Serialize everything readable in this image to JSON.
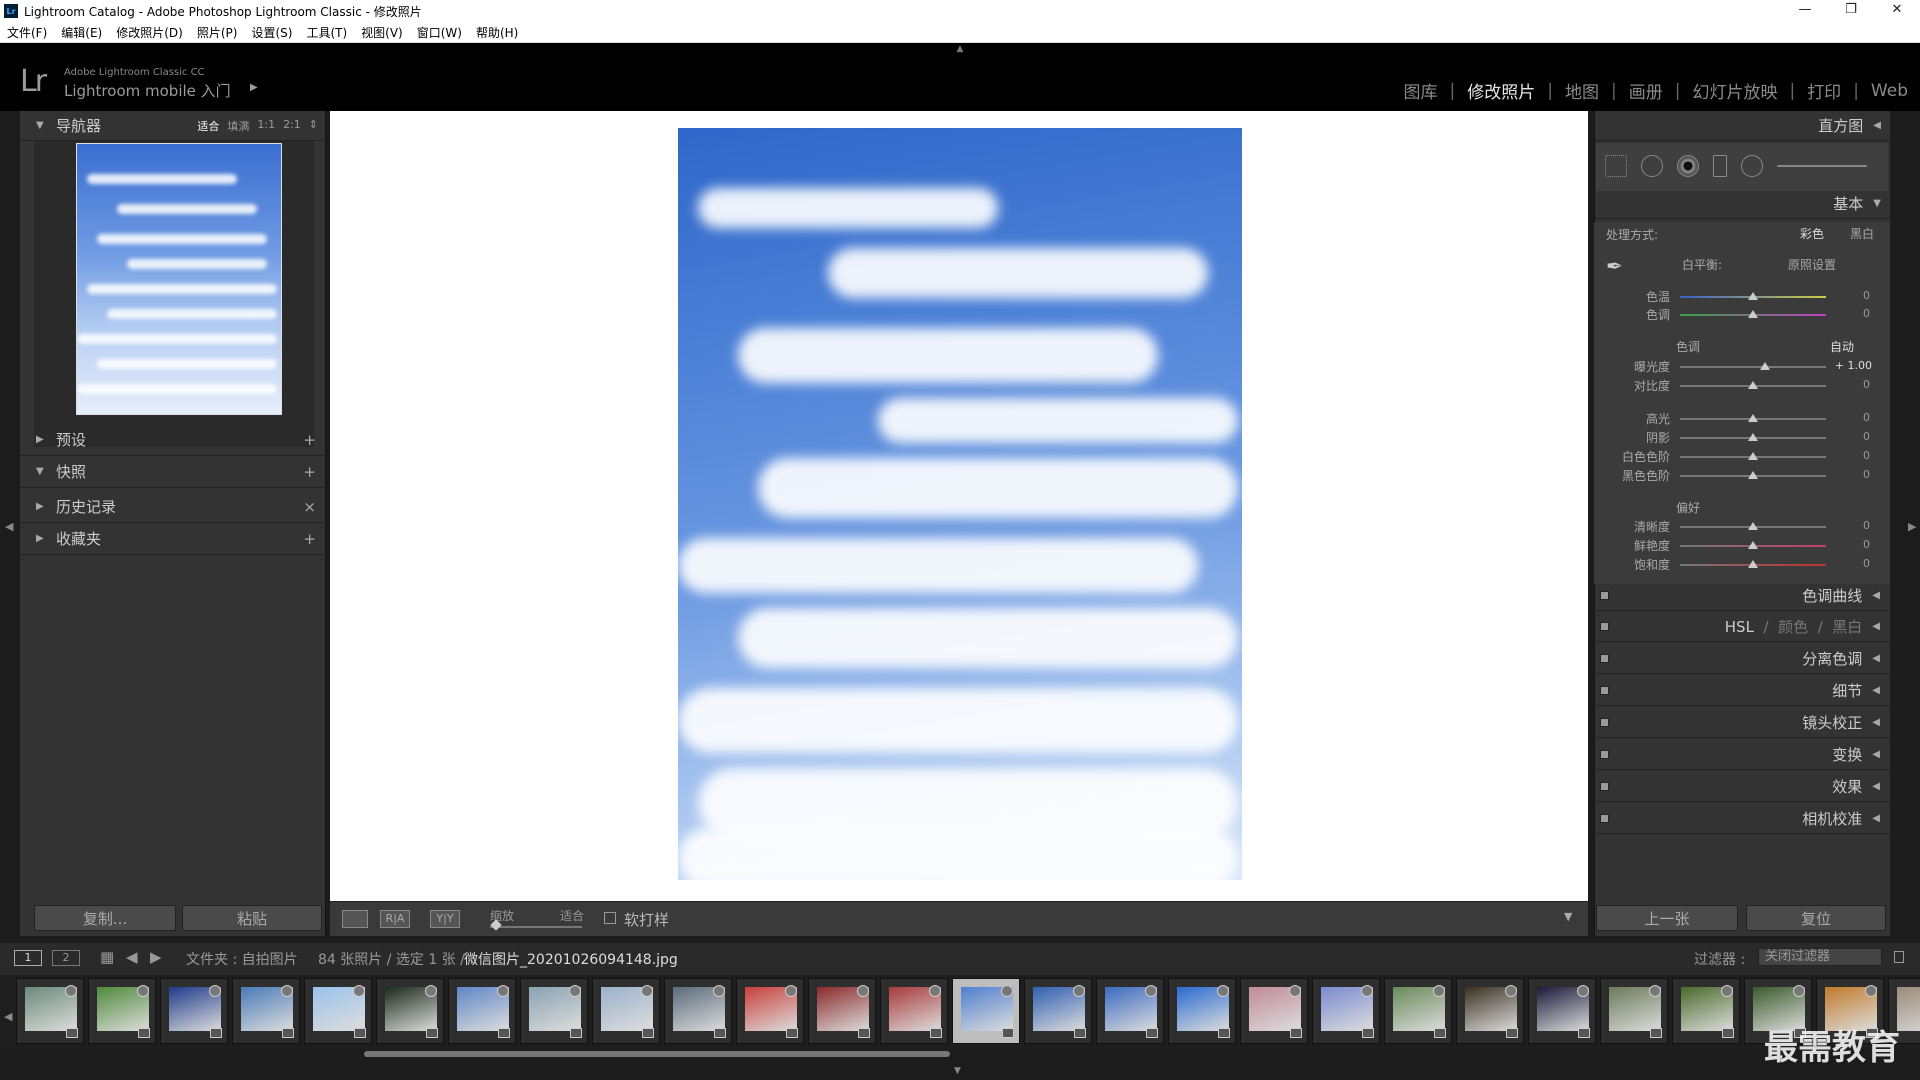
{
  "window": {
    "title": "Lightroom Catalog - Adobe Photoshop Lightroom Classic - 修改照片",
    "app_icon": "Lr",
    "controls": [
      "—",
      "❐",
      "✕"
    ]
  },
  "menu": [
    "文件(F)",
    "编辑(E)",
    "修改照片(D)",
    "照片(P)",
    "设置(S)",
    "工具(T)",
    "视图(V)",
    "窗口(W)",
    "帮助(H)"
  ],
  "identity": {
    "logo": "Lr",
    "product": "Adobe Lightroom Classic CC",
    "subtitle": "Lightroom mobile 入门",
    "arrow": "▶"
  },
  "modules": {
    "items": [
      "图库",
      "修改照片",
      "地图",
      "画册",
      "幻灯片放映",
      "打印",
      "Web"
    ],
    "active": "修改照片",
    "separator": "|"
  },
  "left_panel": {
    "navigator": {
      "label": "导航器",
      "zoom_options": [
        "适合",
        "填满",
        "1:1",
        "2:1"
      ],
      "zoom_active": "适合",
      "zoom_arrow": "⇕"
    },
    "presets": {
      "label": "预设",
      "action": "+"
    },
    "snapshots": {
      "label": "快照",
      "action": "+"
    },
    "history": {
      "label": "历史记录",
      "action": "×"
    },
    "collections": {
      "label": "收藏夹",
      "action": "+"
    },
    "buttons": {
      "copy": "复制...",
      "paste": "粘贴"
    }
  },
  "toolbar": {
    "view_loupe": "▭",
    "view_ra": "R|A",
    "view_yy": "Y|Y",
    "zoom_label": "缩放",
    "zoom_value": "适合",
    "soft_proof": "软打样",
    "dropdown": "▼"
  },
  "right_panel": {
    "histogram": {
      "label": "直方图"
    },
    "basic": {
      "label": "基本",
      "treatment_label": "处理方式:",
      "treatment_color": "彩色",
      "treatment_bw": "黑白",
      "wb_label": "白平衡:",
      "wb_value": "原照设置",
      "temp": {
        "label": "色温",
        "value": "0"
      },
      "tint": {
        "label": "色调",
        "value": "0"
      },
      "tone_label": "色调",
      "auto": "自动",
      "exposure": {
        "label": "曝光度",
        "value": "+ 1.00"
      },
      "contrast": {
        "label": "对比度",
        "value": "0"
      },
      "highlights": {
        "label": "高光",
        "value": "0"
      },
      "shadows": {
        "label": "阴影",
        "value": "0"
      },
      "whites": {
        "label": "白色色阶",
        "value": "0"
      },
      "blacks": {
        "label": "黑色色阶",
        "value": "0"
      },
      "presence_label": "偏好",
      "clarity": {
        "label": "清晰度",
        "value": "0"
      },
      "vibrance": {
        "label": "鲜艳度",
        "value": "0"
      },
      "saturation": {
        "label": "饱和度",
        "value": "0"
      }
    },
    "sections": [
      "色调曲线",
      "HSL / 颜色 / 黑白",
      "分离色调",
      "细节",
      "镜头校正",
      "变换",
      "效果",
      "相机校准"
    ],
    "hsl": {
      "a": "HSL",
      "b": "颜色",
      "c": "黑白",
      "sep": "/"
    },
    "buttons": {
      "previous": "上一张",
      "reset": "复位"
    }
  },
  "filmstrip": {
    "page1": "1",
    "page2": "2",
    "path": "文件夹 : 自拍图片",
    "count": "84 张照片 / 选定 1 张 /",
    "filename": "微信图片_20201026094148.jpg",
    "filter_label": "过滤器 :",
    "filter_value": "关闭过滤器",
    "thumb_colors": [
      "#6a8a7a",
      "#4f8a3a",
      "#1e3a8a",
      "#4a7ab8",
      "#9ac2ec",
      "#1c2a1c",
      "#5f86c6",
      "#8aa2b2",
      "#9bb2cc",
      "#5a6a7a",
      "#c8403a",
      "#8a2a2a",
      "#a83a3a",
      "#4f7fd0",
      "#2f5fb0",
      "#3a6ac0",
      "#2a6ad0",
      "#c08a9a",
      "#7a8ad0",
      "#6a8a5a",
      "#3a3020",
      "#1a1a3a",
      "#6a7a5a",
      "#4a6a2a",
      "#3a5a2a",
      "#c07a2a",
      "#9a8a7a"
    ],
    "selected_index": 13
  },
  "watermark": "最需教育"
}
